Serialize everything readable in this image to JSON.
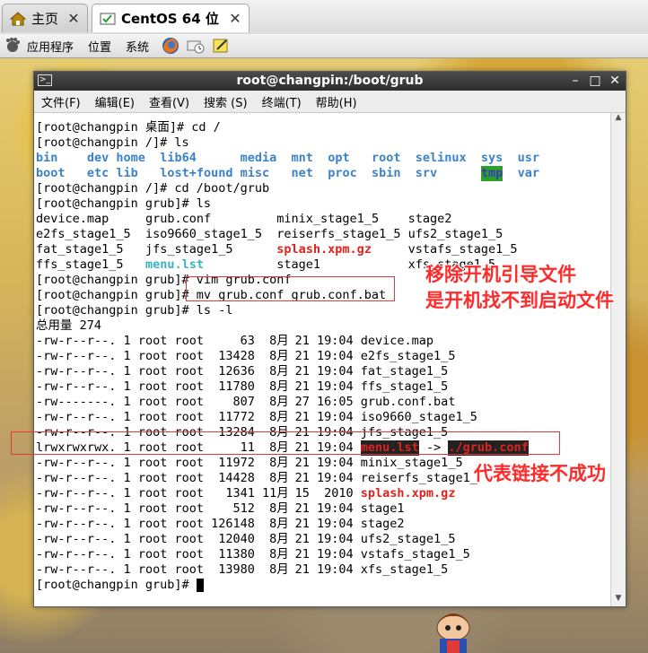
{
  "tabs": [
    {
      "label": "主页"
    },
    {
      "label": "CentOS 64 位"
    }
  ],
  "panel": {
    "applications": "应用程序",
    "places": "位置",
    "system": "系统"
  },
  "window": {
    "title": "root@changpin:/boot/grub"
  },
  "menu": [
    "文件(F)",
    "编辑(E)",
    "查看(V)",
    "搜索 (S)",
    "终端(T)",
    "帮助(H)"
  ],
  "terminal": {
    "lines": [
      "[root@changpin 桌面]# cd /",
      "[root@changpin /]# ls",
      "",
      "",
      "[root@changpin /]# cd /boot/grub",
      "[root@changpin grub]# ls",
      "",
      "",
      "",
      "",
      "[root@changpin grub]# vim grub.conf",
      "[root@changpin grub]# mv grub.conf grub.conf.bat",
      "[root@changpin grub]# ls -l",
      "总用量 274"
    ],
    "ls_root": [
      [
        "bin",
        "dev",
        "home",
        "lib64",
        "media",
        "mnt",
        "opt",
        "root",
        "selinux",
        "sys",
        "usr"
      ],
      [
        "boot",
        "etc",
        "lib",
        "lost+found",
        "misc",
        "net",
        "proc",
        "sbin",
        "srv",
        "tmp",
        "var"
      ]
    ],
    "ls_grub": [
      [
        "device.map",
        "grub.conf",
        "minix_stage1_5",
        "stage2"
      ],
      [
        "e2fs_stage1_5",
        "iso9660_stage1_5",
        "reiserfs_stage1_5",
        "ufs2_stage1_5"
      ],
      [
        "fat_stage1_5",
        "jfs_stage1_5",
        "splash.xpm.gz",
        "vstafs_stage1_5"
      ],
      [
        "ffs_stage1_5",
        "menu.lst",
        "stage1",
        "xfs_stage1_5"
      ]
    ],
    "ll_rows": [
      {
        "perm": "-rw-r--r--.",
        "links": "1",
        "user": "root",
        "group": "root",
        "size": "63",
        "mon": "8月",
        "day": "21",
        "time": "19:04",
        "name": "device.map"
      },
      {
        "perm": "-rw-r--r--.",
        "links": "1",
        "user": "root",
        "group": "root",
        "size": "13428",
        "mon": "8月",
        "day": "21",
        "time": "19:04",
        "name": "e2fs_stage1_5"
      },
      {
        "perm": "-rw-r--r--.",
        "links": "1",
        "user": "root",
        "group": "root",
        "size": "12636",
        "mon": "8月",
        "day": "21",
        "time": "19:04",
        "name": "fat_stage1_5"
      },
      {
        "perm": "-rw-r--r--.",
        "links": "1",
        "user": "root",
        "group": "root",
        "size": "11780",
        "mon": "8月",
        "day": "21",
        "time": "19:04",
        "name": "ffs_stage1_5"
      },
      {
        "perm": "-rw-------.",
        "links": "1",
        "user": "root",
        "group": "root",
        "size": "807",
        "mon": "8月",
        "day": "27",
        "time": "16:05",
        "name": "grub.conf.bat"
      },
      {
        "perm": "-rw-r--r--.",
        "links": "1",
        "user": "root",
        "group": "root",
        "size": "11772",
        "mon": "8月",
        "day": "21",
        "time": "19:04",
        "name": "iso9660_stage1_5"
      },
      {
        "perm": "-rw-r--r--.",
        "links": "1",
        "user": "root",
        "group": "root",
        "size": "13284",
        "mon": "8月",
        "day": "21",
        "time": "19:04",
        "name": "jfs_stage1_5"
      },
      {
        "perm": "lrwxrwxrwx.",
        "links": "1",
        "user": "root",
        "group": "root",
        "size": "11",
        "mon": "8月",
        "day": "21",
        "time": "19:04",
        "name": "menu.lst",
        "arrow": "->",
        "target": "./grub.conf"
      },
      {
        "perm": "-rw-r--r--.",
        "links": "1",
        "user": "root",
        "group": "root",
        "size": "11972",
        "mon": "8月",
        "day": "21",
        "time": "19:04",
        "name": "minix_stage1_5"
      },
      {
        "perm": "-rw-r--r--.",
        "links": "1",
        "user": "root",
        "group": "root",
        "size": "14428",
        "mon": "8月",
        "day": "21",
        "time": "19:04",
        "name": "reiserfs_stage1_"
      },
      {
        "perm": "-rw-r--r--.",
        "links": "1",
        "user": "root",
        "group": "root",
        "size": "1341",
        "mon": "11月",
        "day": "15",
        "time": "2010",
        "name": "splash.xpm.gz"
      },
      {
        "perm": "-rw-r--r--.",
        "links": "1",
        "user": "root",
        "group": "root",
        "size": "512",
        "mon": "8月",
        "day": "21",
        "time": "19:04",
        "name": "stage1"
      },
      {
        "perm": "-rw-r--r--.",
        "links": "1",
        "user": "root",
        "group": "root",
        "size": "126148",
        "mon": "8月",
        "day": "21",
        "time": "19:04",
        "name": "stage2"
      },
      {
        "perm": "-rw-r--r--.",
        "links": "1",
        "user": "root",
        "group": "root",
        "size": "12040",
        "mon": "8月",
        "day": "21",
        "time": "19:04",
        "name": "ufs2_stage1_5"
      },
      {
        "perm": "-rw-r--r--.",
        "links": "1",
        "user": "root",
        "group": "root",
        "size": "11380",
        "mon": "8月",
        "day": "21",
        "time": "19:04",
        "name": "vstafs_stage1_5"
      },
      {
        "perm": "-rw-r--r--.",
        "links": "1",
        "user": "root",
        "group": "root",
        "size": "13980",
        "mon": "8月",
        "day": "21",
        "time": "19:04",
        "name": "xfs_stage1_5"
      }
    ],
    "final_prompt": "[root@changpin grub]# "
  },
  "annotations": {
    "remove_note_1": "移除开机引导文件",
    "remove_note_2": "是开机找不到启动文件",
    "link_note": "代表链接不成功"
  },
  "colors": {
    "directory": "#3b82c9",
    "archive": "#e2211c",
    "symlink": "#34b5c9",
    "annotation": "#ff2a2a"
  }
}
